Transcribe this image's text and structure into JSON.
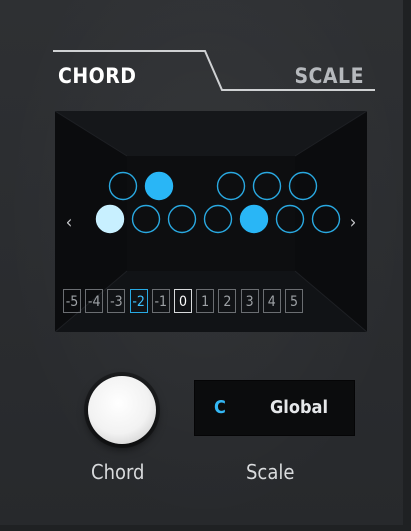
{
  "tabs": [
    {
      "label": "CHORD",
      "active": true
    },
    {
      "label": "SCALE",
      "active": false
    }
  ],
  "colors": {
    "accent_blue": "#29b6f6",
    "highlight_white": "#c8f0ff",
    "outline": "#29a8e0",
    "text": "#d9dbdd"
  },
  "keyboard": {
    "top_row": [
      false,
      true,
      false,
      false,
      false
    ],
    "bottom_row": [
      true,
      false,
      false,
      false,
      true,
      false,
      false
    ],
    "root_note_index": 0,
    "prev_icon": "chevron-left-icon",
    "next_icon": "chevron-right-icon",
    "prev_label": "‹",
    "next_label": "›"
  },
  "octaves": [
    "-5",
    "-4",
    "-3",
    "-2",
    "-1",
    "0",
    "1",
    "2",
    "3",
    "4",
    "5"
  ],
  "octave_selected_blue": "-2",
  "octave_selected_white": "0",
  "controls": {
    "chord_label": "Chord",
    "scale_label": "Scale",
    "scale_key": "C",
    "scale_name": "Global"
  }
}
